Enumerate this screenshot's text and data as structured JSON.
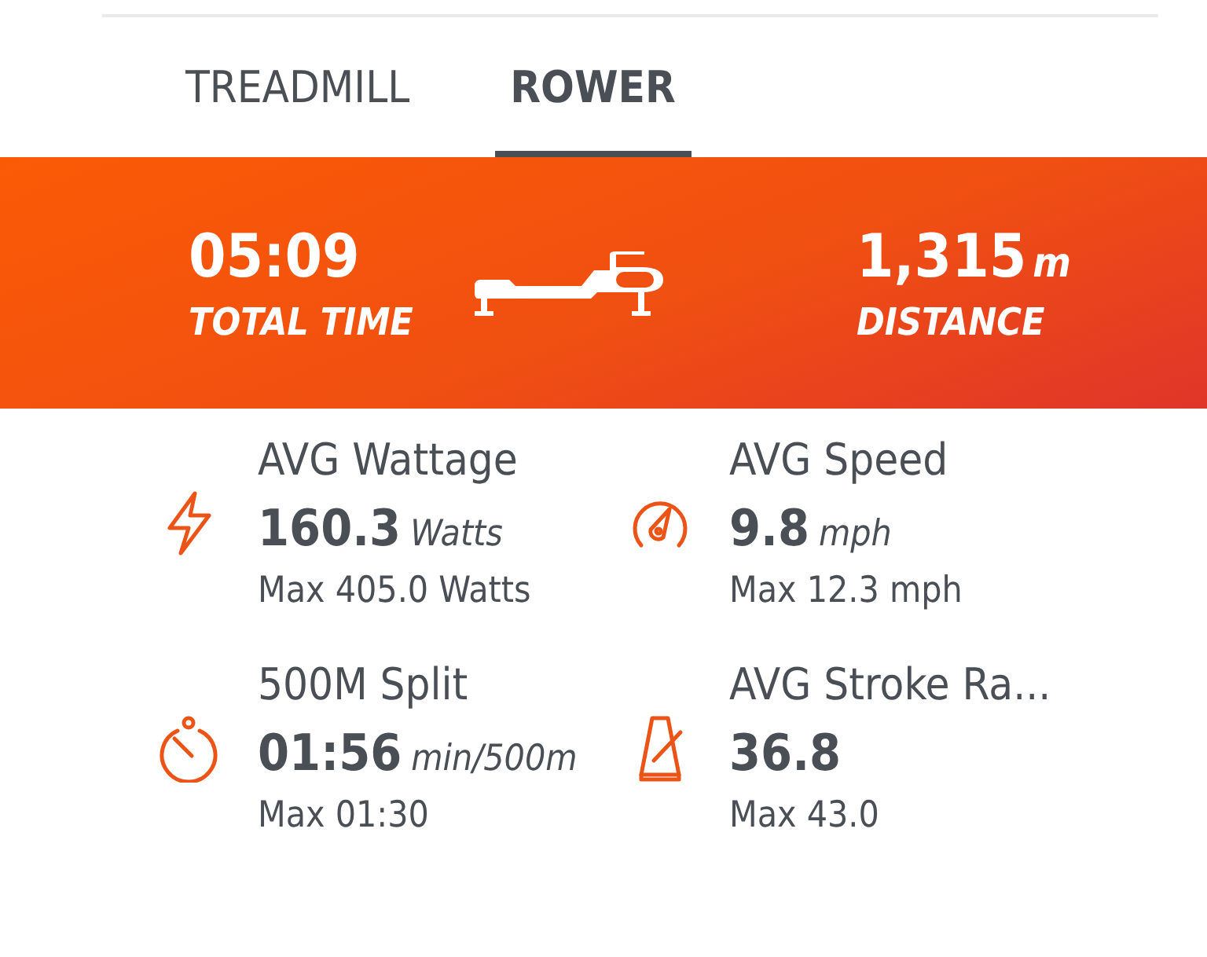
{
  "tabs": [
    {
      "label": "TREADMILL",
      "selected": false
    },
    {
      "label": "ROWER",
      "selected": true
    }
  ],
  "banner": {
    "left": {
      "value": "05:09",
      "label": "TOTAL TIME"
    },
    "right": {
      "value": "1,315",
      "unit": "m",
      "label": "DISTANCE"
    }
  },
  "stats": [
    {
      "kind": "bolt",
      "title": "AVG Wattage",
      "value": "160.3",
      "unit": "Watts",
      "max": "Max 405.0 Watts"
    },
    {
      "kind": "gauge",
      "title": "AVG Speed",
      "value": "9.8",
      "unit": "mph",
      "max": "Max 12.3 mph"
    },
    {
      "kind": "stopwatch",
      "title": "500M Split",
      "value": "01:56",
      "unit": "min/500m",
      "max": "Max 01:30"
    },
    {
      "kind": "metronome",
      "title": "AVG Stroke Ra...",
      "value": "36.8",
      "max": "Max 43.0"
    }
  ]
}
